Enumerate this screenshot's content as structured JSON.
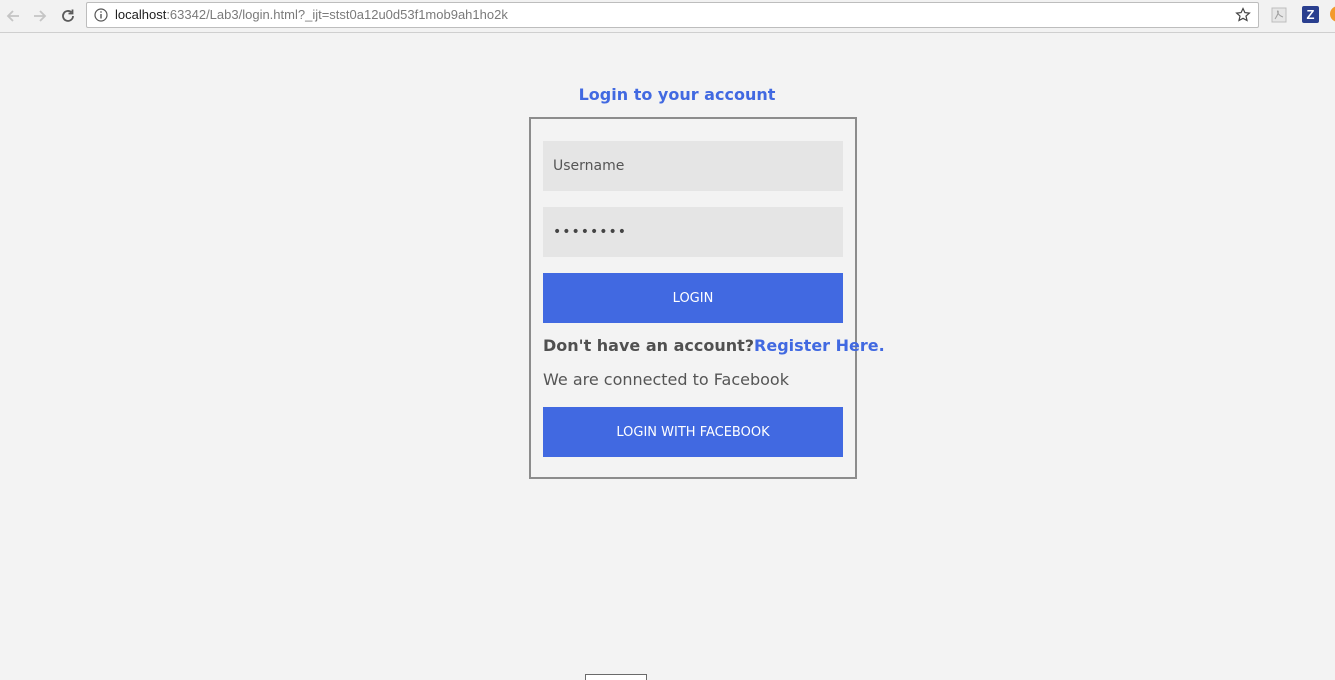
{
  "browser": {
    "url_host": "localhost",
    "url_rest": ":63342/Lab3/login.html?_ijt=stst0a12u0d53f1mob9ah1ho2k",
    "icons": [
      "back-arrow-icon",
      "forward-arrow-icon",
      "reload-icon",
      "info-icon",
      "star-icon",
      "pdf-extension-icon",
      "z-extension-icon"
    ],
    "z_ext_label": "Z"
  },
  "login": {
    "title": "Login to your account",
    "username_placeholder": "Username",
    "password_value": "••••••••",
    "login_button": "LOGIN",
    "no_account_text": "Don't have an account?",
    "register_link": "Register Here.",
    "connected_text": "We are connected to Facebook",
    "facebook_button": "LOGIN WITH FACEBOOK"
  },
  "colors": {
    "accent": "#4169e1",
    "page_background": "#f3f3f3",
    "input_background": "#e5e5e5"
  }
}
